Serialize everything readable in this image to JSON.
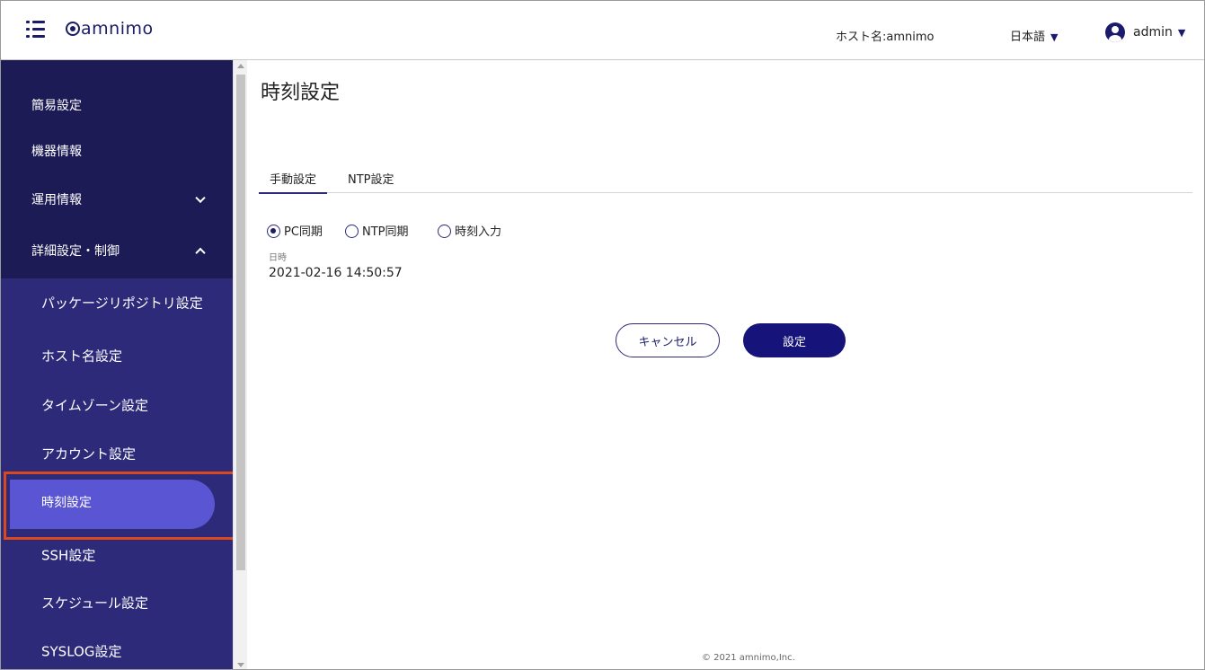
{
  "header": {
    "brand": "amnimo",
    "hostname_text": "ホスト名:amnimo",
    "language": "日本語",
    "user": "admin",
    "dropdown_glyph": "▼"
  },
  "sidebar": {
    "items": [
      {
        "label": "簡易設定"
      },
      {
        "label": "機器情報"
      },
      {
        "label": "運用情報"
      },
      {
        "label": "詳細設定・制御"
      },
      {
        "label": "パッケージリポジトリ設定"
      },
      {
        "label": "ホスト名設定"
      },
      {
        "label": "タイムゾーン設定"
      },
      {
        "label": "アカウント設定"
      },
      {
        "label": "時刻設定"
      },
      {
        "label": "SSH設定"
      },
      {
        "label": "スケジュール設定"
      },
      {
        "label": "SYSLOG設定"
      }
    ],
    "active_index": 8
  },
  "main": {
    "title": "時刻設定",
    "tabs": [
      {
        "label": "手動設定",
        "active": true
      },
      {
        "label": "NTP設定",
        "active": false
      }
    ],
    "radios": [
      {
        "label": "PC同期",
        "checked": true
      },
      {
        "label": "NTP同期",
        "checked": false
      },
      {
        "label": "時刻入力",
        "checked": false
      }
    ],
    "datetime_label": "日時",
    "datetime_value": "2021-02-16 14:50:57",
    "cancel_label": "キャンセル",
    "save_label": "設定"
  },
  "footer": {
    "copyright": "© 2021 amnimo,Inc."
  },
  "colors": {
    "sidebar_dark": "#1c1b55",
    "sidebar": "#2d2a7a",
    "active_pill": "#5a55d2",
    "primary_button": "#16137a",
    "highlight_outline": "#d9481e"
  },
  "icons": [
    "hamburger-menu-icon",
    "amnimo-logo",
    "user-avatar-icon",
    "chevron-down-icon",
    "chevron-up-icon"
  ]
}
